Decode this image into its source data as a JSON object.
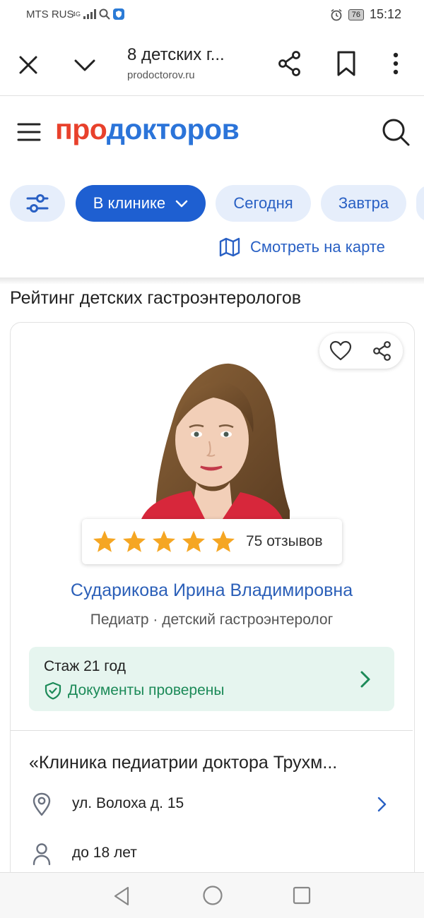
{
  "status_bar": {
    "carrier": "MTS RUS",
    "network": "4G",
    "battery": "76",
    "time": "15:12"
  },
  "browser": {
    "tab_title": "8 детских г...",
    "url": "prodoctorov.ru",
    "icons": [
      "close-icon",
      "chevron-down-icon",
      "share-icon",
      "bookmark-icon",
      "more-icon"
    ]
  },
  "site": {
    "logo_part1": "про",
    "logo_part2": "докторов",
    "brand_red": "#e8412c",
    "brand_blue": "#2b74d9"
  },
  "filters": {
    "clinic": "В клинике",
    "today": "Сегодня",
    "tomorrow": "Завтра",
    "map_link": "Смотреть на карте"
  },
  "page": {
    "section_title": "Рейтинг детских гастроэнтерологов"
  },
  "doctor": {
    "stars": 5,
    "reviews": "75 отзывов",
    "name": "Сударикова Ирина Владимировна",
    "specialty": "Педиатр · детский гастроэнтеролог",
    "experience": "Стаж 21 год",
    "documents": "Документы проверены",
    "clinic": "«Клиника педиатрии доктора Трухм...",
    "address": "ул. Волоха д. 15",
    "age": "до 18 лет"
  }
}
